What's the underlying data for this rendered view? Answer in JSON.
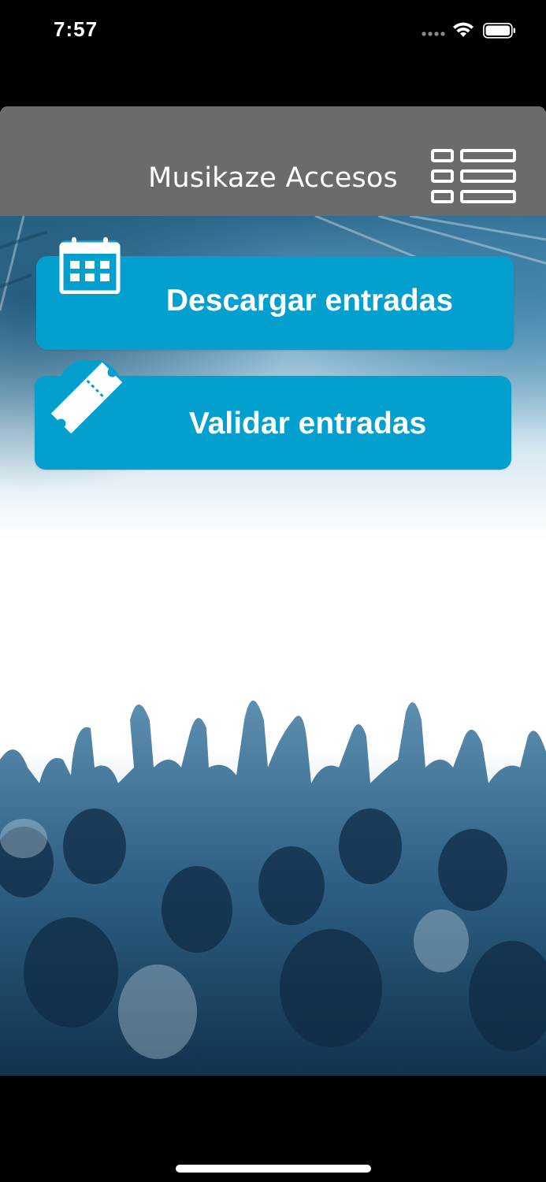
{
  "status_bar": {
    "time": "7:57"
  },
  "nav": {
    "title": "Musikaze Accesos",
    "menu_icon": "list-menu-icon",
    "bar_color": "#6b6b6b"
  },
  "actions": {
    "download": {
      "label": "Descargar entradas",
      "icon": "calendar-icon"
    },
    "validate": {
      "label": "Validar entradas",
      "icon": "ticket-icon"
    },
    "button_color": "#03a0cf"
  },
  "background": {
    "description_icon": "concert-crowd-image"
  }
}
